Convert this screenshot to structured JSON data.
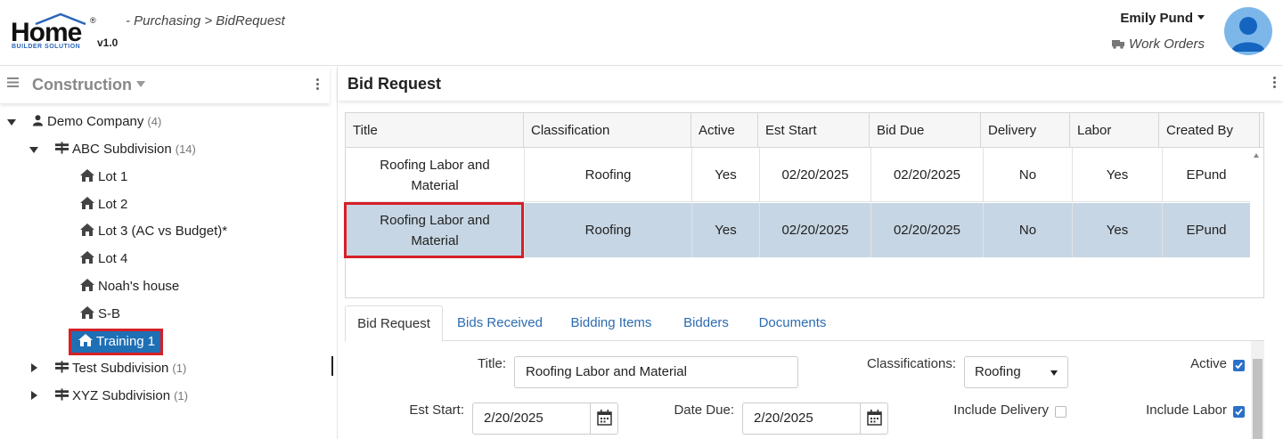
{
  "app": {
    "logo_text": "Home",
    "logo_subtext": "BUILDER SOLUTION",
    "logo_registered": "®",
    "version": "v1.0",
    "breadcrumb": "- Purchasing > BidRequest"
  },
  "user": {
    "name": "Emily Pund",
    "work_orders_label": "Work Orders"
  },
  "sidebar": {
    "title": "Construction",
    "tree": {
      "company": {
        "label": "Demo Company",
        "count": "(4)"
      },
      "subdivisions": [
        {
          "label": "ABC Subdivision",
          "count": "(14)",
          "expanded": true
        },
        {
          "label": "Test Subdivision",
          "count": "(1)",
          "expanded": false
        },
        {
          "label": "XYZ Subdivision",
          "count": "(1)",
          "expanded": false
        }
      ],
      "lots": [
        "Lot 1",
        "Lot 2",
        "Lot 3 (AC vs Budget)*",
        "Lot 4",
        "Noah's house",
        "S-B",
        "Training 1"
      ],
      "selected": "Training 1"
    }
  },
  "main": {
    "title": "Bid Request",
    "grid": {
      "columns": [
        "Title",
        "Classification",
        "Active",
        "Est Start",
        "Bid Due",
        "Delivery",
        "Labor",
        "Created By"
      ],
      "rows": [
        {
          "title_line1": "Roofing Labor and",
          "title_line2": "Material",
          "classification": "Roofing",
          "active": "Yes",
          "est_start": "02/20/2025",
          "bid_due": "02/20/2025",
          "delivery": "No",
          "labor": "Yes",
          "created_by": "EPund"
        },
        {
          "title_line1": "Roofing Labor and",
          "title_line2": "Material",
          "classification": "Roofing",
          "active": "Yes",
          "est_start": "02/20/2025",
          "bid_due": "02/20/2025",
          "delivery": "No",
          "labor": "Yes",
          "created_by": "EPund"
        }
      ]
    },
    "tabs": [
      "Bid Request",
      "Bids Received",
      "Bidding Items",
      "Bidders",
      "Documents"
    ],
    "form": {
      "title_label": "Title:",
      "title_value": "Roofing Labor and Material",
      "classifications_label": "Classifications:",
      "classifications_value": "Roofing",
      "active_label": "Active",
      "active_checked": true,
      "est_start_label": "Est Start:",
      "est_start_value": "2/20/2025",
      "date_due_label": "Date Due:",
      "date_due_value": "2/20/2025",
      "include_delivery_label": "Include Delivery",
      "include_delivery_checked": false,
      "include_labor_label": "Include Labor",
      "include_labor_checked": true
    }
  },
  "colors": {
    "accent": "#1f6fb5",
    "highlight_border": "#d62027",
    "selected_row": "#c6d6e4",
    "link": "#2b6cb0",
    "avatar_bg": "#7db7ea"
  }
}
